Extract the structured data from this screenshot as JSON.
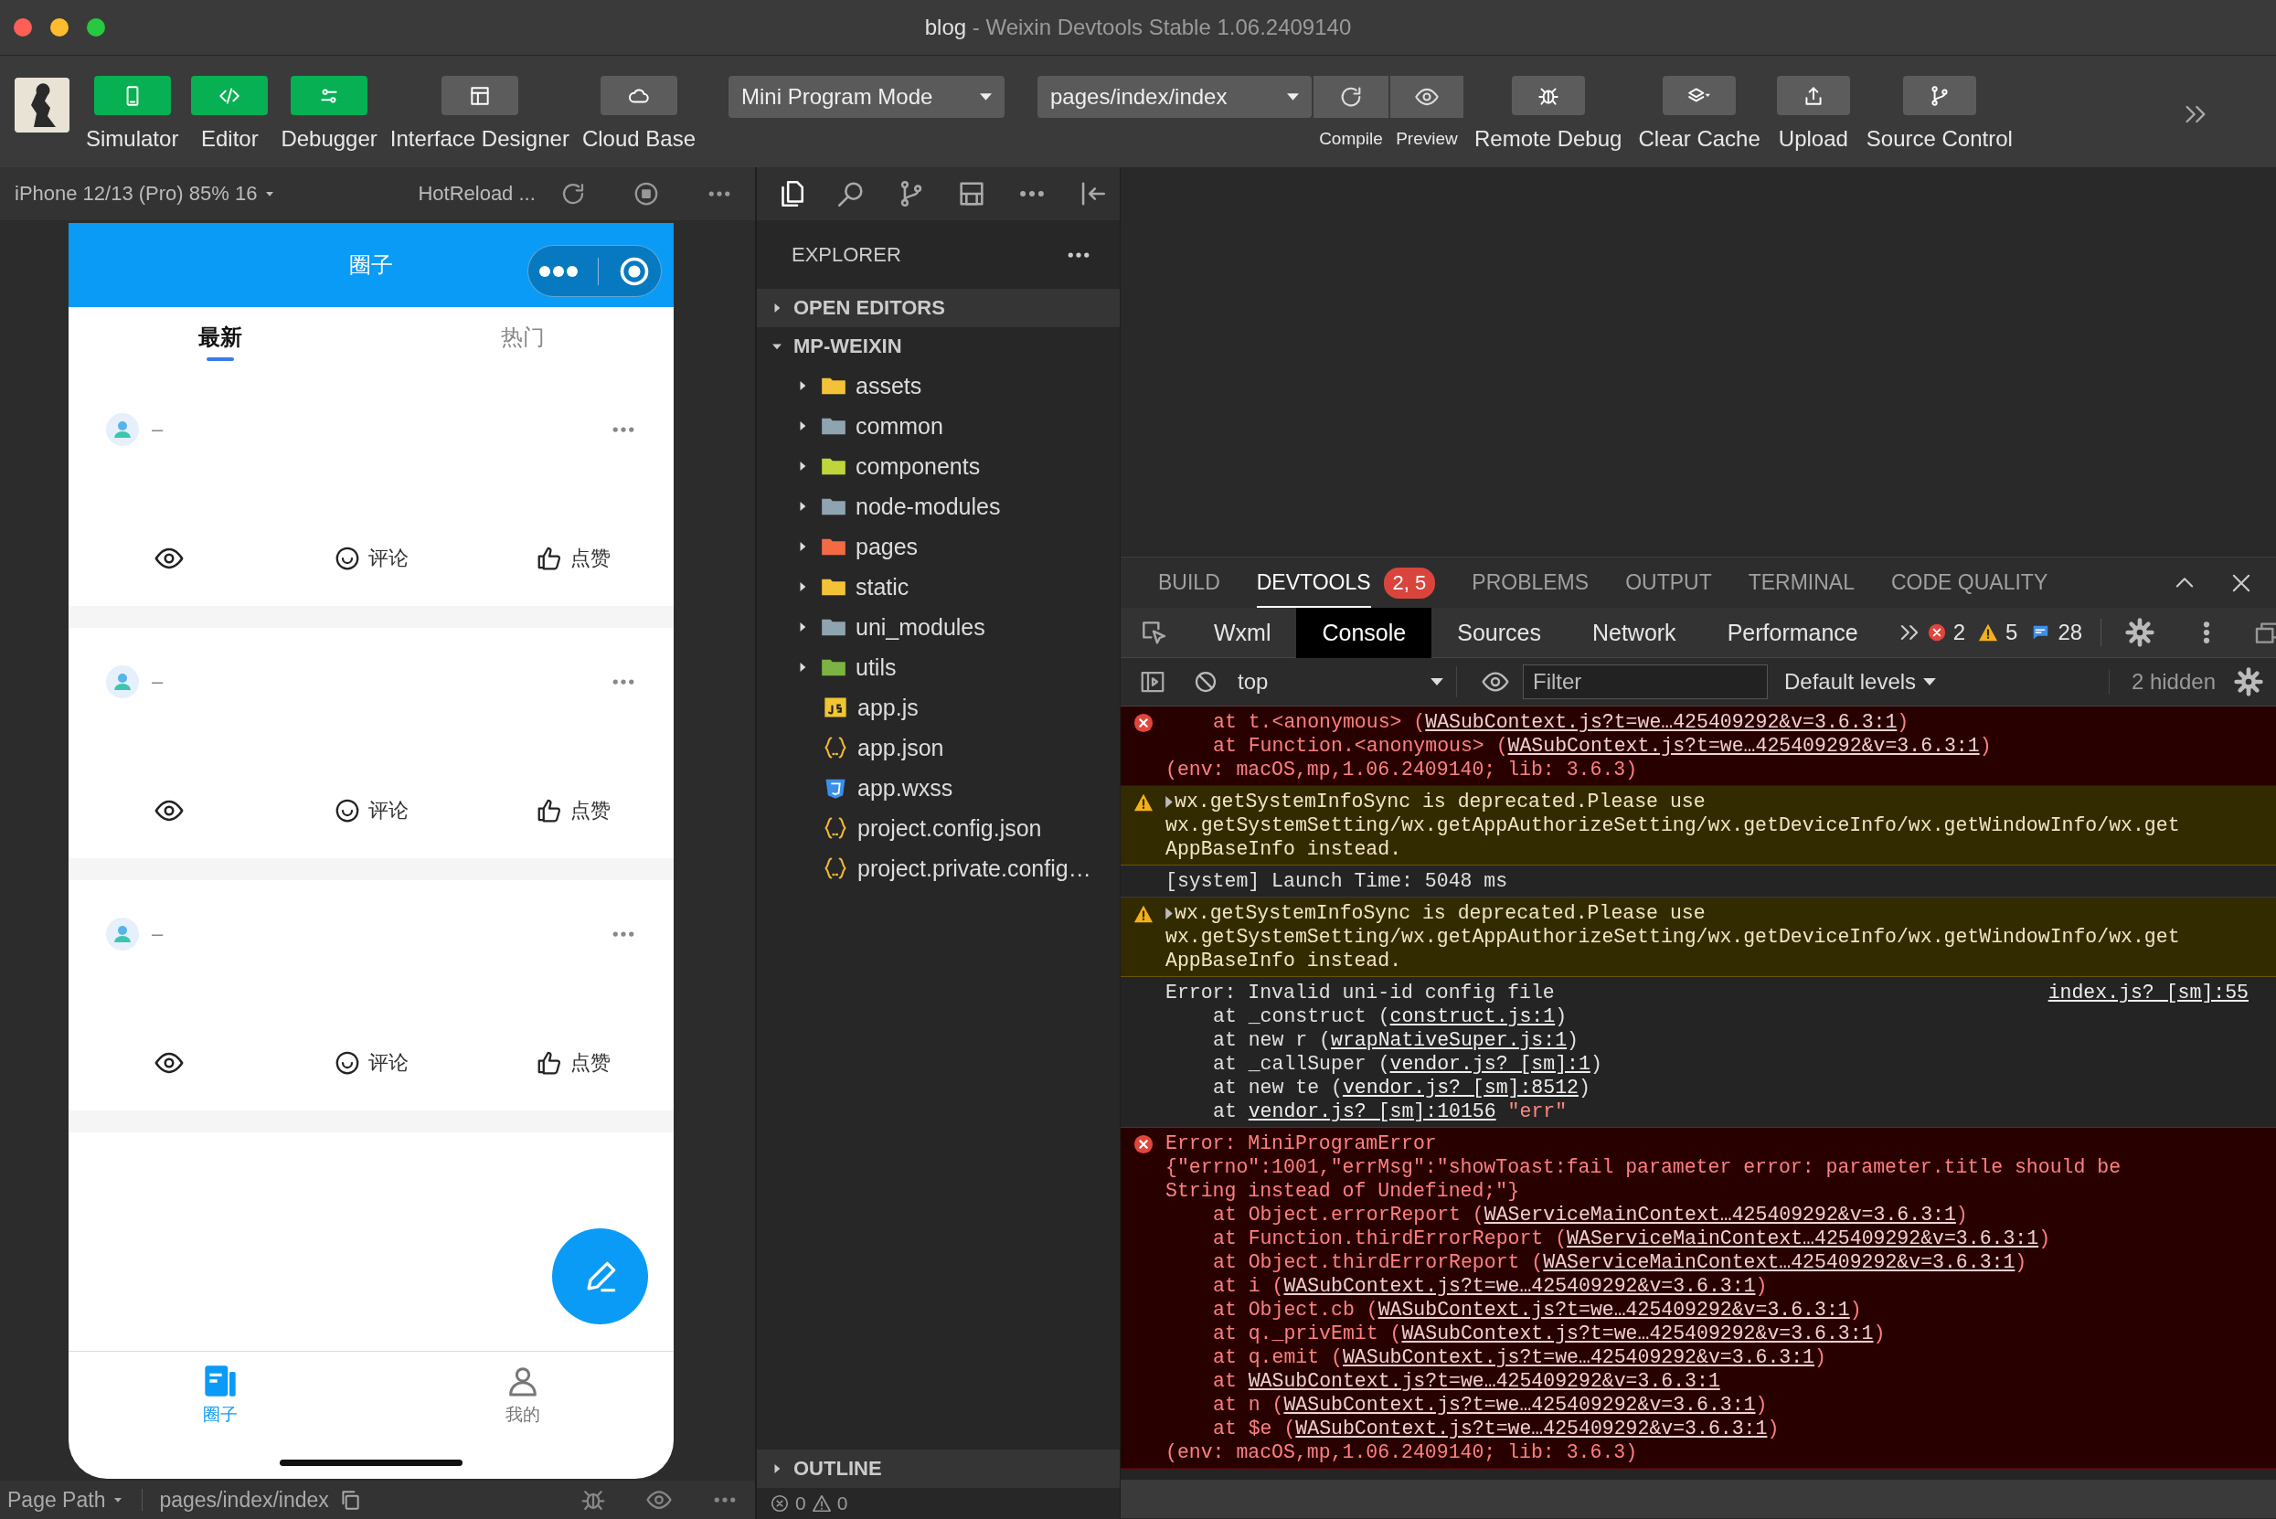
{
  "window": {
    "title": "blog",
    "subtitle": "- Weixin Devtools Stable 1.06.2409140"
  },
  "toolbar": {
    "views": [
      {
        "label": "Simulator",
        "on": true
      },
      {
        "label": "Editor",
        "on": true
      },
      {
        "label": "Debugger",
        "on": true
      },
      {
        "label": "Interface Designer",
        "on": false
      },
      {
        "label": "Cloud Base",
        "on": false
      }
    ],
    "mode": "Mini Program Mode",
    "page": "pages/index/index",
    "compile": "Compile",
    "preview": "Preview",
    "actions": [
      {
        "label": "Remote Debug"
      },
      {
        "label": "Clear Cache"
      },
      {
        "label": "Upload"
      },
      {
        "label": "Source Control"
      }
    ]
  },
  "simulator": {
    "device": "iPhone 12/13 (Pro) 85% 16",
    "hot_reload": "HotReload ...",
    "nav_title": "圈子",
    "tabs": [
      {
        "label": "最新",
        "selected": true
      },
      {
        "label": "热门",
        "selected": false
      }
    ],
    "posts": [
      {
        "author": "–",
        "comment": "评论",
        "like": "点赞"
      },
      {
        "author": "–",
        "comment": "评论",
        "like": "点赞"
      },
      {
        "author": "–",
        "comment": "评论",
        "like": "点赞"
      }
    ],
    "tabbar": [
      {
        "label": "圈子",
        "selected": true
      },
      {
        "label": "我的",
        "selected": false
      }
    ]
  },
  "page_path": {
    "label": "Page Path",
    "value": "pages/index/index"
  },
  "explorer": {
    "title": "EXPLORER",
    "sections": [
      {
        "label": "OPEN EDITORS",
        "expanded": false
      },
      {
        "label": "MP-WEIXIN",
        "expanded": true,
        "children": [
          {
            "name": "assets",
            "kind": "folder",
            "expanded": false,
            "color": "#f4c237"
          },
          {
            "name": "common",
            "kind": "folder",
            "expanded": false,
            "color": "#8fa4b1"
          },
          {
            "name": "components",
            "kind": "folder",
            "expanded": false,
            "color": "#c0d53a"
          },
          {
            "name": "node-modules",
            "kind": "folder",
            "expanded": false,
            "color": "#8fa4b1"
          },
          {
            "name": "pages",
            "kind": "folder",
            "expanded": false,
            "color": "#f26b45"
          },
          {
            "name": "static",
            "kind": "folder",
            "expanded": false,
            "color": "#f4c237"
          },
          {
            "name": "uni_modules",
            "kind": "folder",
            "expanded": false,
            "color": "#8fa4b1"
          },
          {
            "name": "utils",
            "kind": "folder",
            "expanded": false,
            "color": "#7cb342"
          },
          {
            "name": "app.js",
            "kind": "js"
          },
          {
            "name": "app.json",
            "kind": "json"
          },
          {
            "name": "app.wxss",
            "kind": "css"
          },
          {
            "name": "project.config.json",
            "kind": "json"
          },
          {
            "name": "project.private.config…",
            "kind": "json"
          }
        ]
      },
      {
        "label": "OUTLINE",
        "expanded": false
      }
    ],
    "errors": "0",
    "warnings": "0"
  },
  "panel": {
    "tabs": [
      {
        "label": "BUILD",
        "selected": false
      },
      {
        "label": "DEVTOOLS",
        "selected": true,
        "badge": "2, 5"
      },
      {
        "label": "PROBLEMS",
        "selected": false
      },
      {
        "label": "OUTPUT",
        "selected": false
      },
      {
        "label": "TERMINAL",
        "selected": false
      },
      {
        "label": "CODE QUALITY",
        "selected": false
      }
    ]
  },
  "devtools": {
    "tabs": [
      {
        "label": "Wxml",
        "selected": false
      },
      {
        "label": "Console",
        "selected": true
      },
      {
        "label": "Sources",
        "selected": false
      },
      {
        "label": "Network",
        "selected": false
      },
      {
        "label": "Performance",
        "selected": false
      }
    ],
    "errors": "2",
    "warnings": "5",
    "messages": "28",
    "context": "top",
    "filter_placeholder": "Filter",
    "levels": "Default levels",
    "hidden": "2 hidden"
  },
  "console": [
    {
      "kind": "error",
      "expandable": false,
      "stack": [
        {
          "text": "at t.<anonymous> (",
          "link": "WASubContext.js?t=we…425409292&v=3.6.3:1",
          "tail": ")"
        },
        {
          "text": "at Function.<anonymous> (",
          "link": "WASubContext.js?t=we…425409292&v=3.6.3:1",
          "tail": ")"
        }
      ],
      "footer": "(env: macOS,mp,1.06.2409140; lib: 3.6.3)"
    },
    {
      "kind": "warning",
      "expandable": true,
      "message": [
        "wx.getSystemInfoSync is deprecated.Please use",
        "wx.getSystemSetting/wx.getAppAuthorizeSetting/wx.getDeviceInfo/wx.getWindowInfo/wx.get",
        "AppBaseInfo instead."
      ]
    },
    {
      "kind": "info",
      "expandable": false,
      "message": [
        "[system] Launch Time: 5048 ms"
      ]
    },
    {
      "kind": "warning",
      "expandable": true,
      "message": [
        "wx.getSystemInfoSync is deprecated.Please use",
        "wx.getSystemSetting/wx.getAppAuthorizeSetting/wx.getDeviceInfo/wx.getWindowInfo/wx.get",
        "AppBaseInfo instead."
      ]
    },
    {
      "kind": "log",
      "expandable": false,
      "message": [
        "Error: Invalid uni-id config file"
      ],
      "source": "index.js? [sm]:55",
      "stack": [
        {
          "text": "at _construct (",
          "link": "construct.js:1",
          "tail": ")"
        },
        {
          "text": "at new r (",
          "link": "wrapNativeSuper.js:1",
          "tail": ")"
        },
        {
          "text": "at _callSuper (",
          "link": "vendor.js? [sm]:1",
          "tail": ")"
        },
        {
          "text": "at new te (",
          "link": "vendor.js? [sm]:8512",
          "tail": ")"
        },
        {
          "text": "at ",
          "link": "vendor.js? [sm]:10156",
          "value": "\"err\""
        }
      ]
    },
    {
      "kind": "error",
      "expandable": false,
      "message": [
        "Error: MiniProgramError",
        "{\"errno\":1001,\"errMsg\":\"showToast:fail parameter error: parameter.title should be",
        "String instead of Undefined;\"}"
      ],
      "stack": [
        {
          "text": "at Object.errorReport (",
          "link": "WAServiceMainContext…425409292&v=3.6.3:1",
          "tail": ")"
        },
        {
          "text": "at Function.thirdErrorReport (",
          "link": "WAServiceMainContext…425409292&v=3.6.3:1",
          "tail": ")"
        },
        {
          "text": "at Object.thirdErrorReport (",
          "link": "WAServiceMainContext…425409292&v=3.6.3:1",
          "tail": ")"
        },
        {
          "text": "at i (",
          "link": "WASubContext.js?t=we…425409292&v=3.6.3:1",
          "tail": ")"
        },
        {
          "text": "at Object.cb (",
          "link": "WASubContext.js?t=we…425409292&v=3.6.3:1",
          "tail": ")"
        },
        {
          "text": "at q._privEmit (",
          "link": "WASubContext.js?t=we…425409292&v=3.6.3:1",
          "tail": ")"
        },
        {
          "text": "at q.emit (",
          "link": "WASubContext.js?t=we…425409292&v=3.6.3:1",
          "tail": ")"
        },
        {
          "text": "at ",
          "link": "WASubContext.js?t=we…425409292&v=3.6.3:1"
        },
        {
          "text": "at n (",
          "link": "WASubContext.js?t=we…425409292&v=3.6.3:1",
          "tail": ")"
        },
        {
          "text": "at $e (",
          "link": "WASubContext.js?t=we…425409292&v=3.6.3:1",
          "tail": ")"
        }
      ],
      "footer": "(env: macOS,mp,1.06.2409140; lib: 3.6.3)"
    }
  ]
}
